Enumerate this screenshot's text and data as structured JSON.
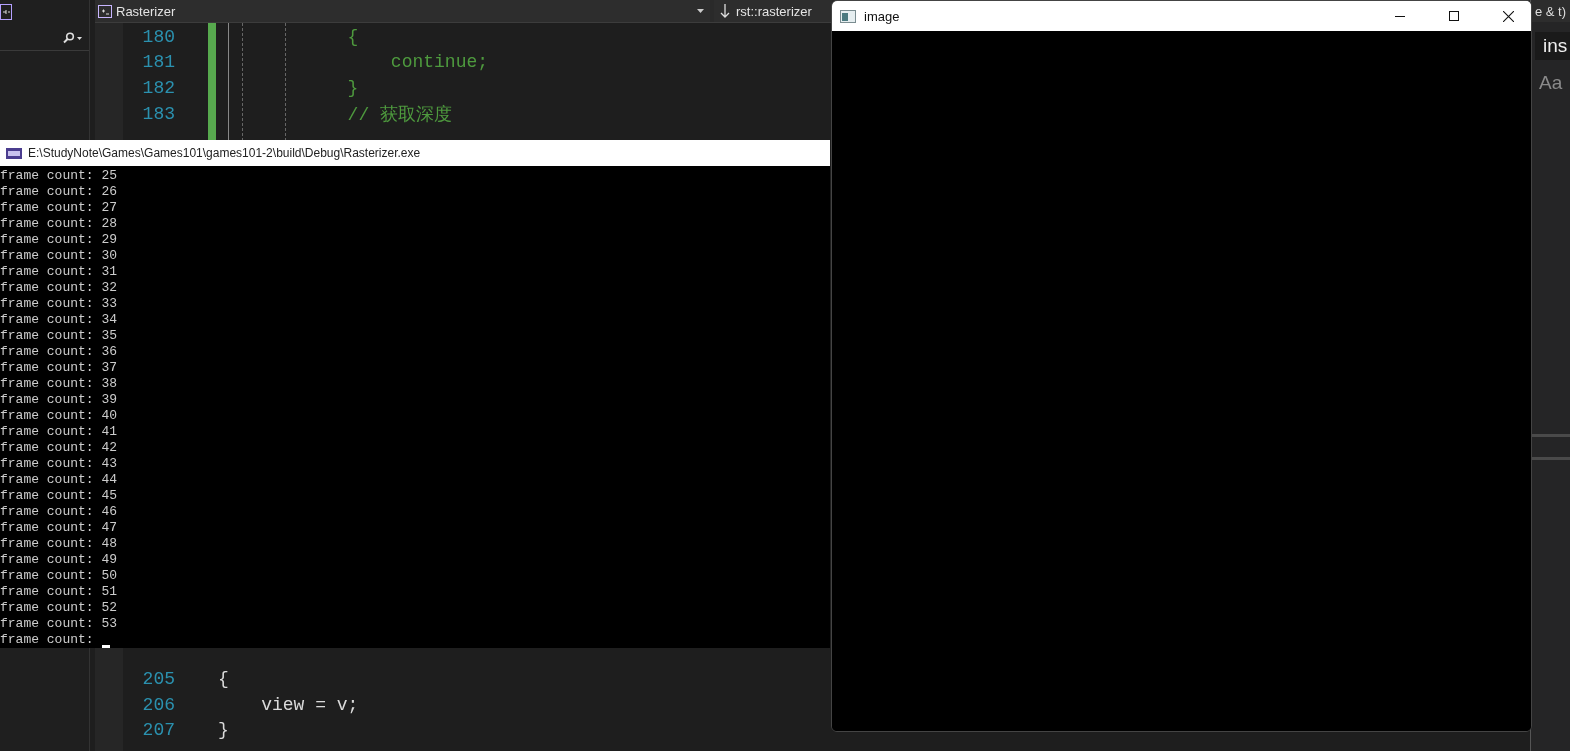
{
  "ide": {
    "nav_bar": {
      "file": "Rasterizer",
      "scope": "rst::rasterizer"
    },
    "code_top": [
      {
        "number": "180",
        "tokens": [
          {
            "kind": "inactive",
            "text": "            {"
          }
        ]
      },
      {
        "number": "181",
        "tokens": [
          {
            "kind": "inactive",
            "text": "                continue;"
          }
        ]
      },
      {
        "number": "182",
        "tokens": [
          {
            "kind": "inactive",
            "text": "            }"
          }
        ]
      },
      {
        "number": "183",
        "tokens": [
          {
            "kind": "inactive",
            "text": "            // 获取深度"
          }
        ]
      }
    ],
    "code_bottom": [
      {
        "number": "205",
        "tokens": [
          {
            "kind": "plain",
            "text": "{"
          }
        ]
      },
      {
        "number": "206",
        "tokens": [
          {
            "kind": "plain",
            "text": "    view = v;"
          }
        ]
      },
      {
        "number": "207",
        "tokens": [
          {
            "kind": "plain",
            "text": "}"
          }
        ]
      }
    ],
    "right_panel": {
      "header_fragment": "e & t)",
      "search_value": "ins",
      "case_toggle": "Aa"
    }
  },
  "console_window": {
    "title": "E:\\StudyNote\\Games\\Games101\\games101-2\\build\\Debug\\Rasterizer.exe",
    "lines": [
      "frame count: 25",
      "frame count: 26",
      "frame count: 27",
      "frame count: 28",
      "frame count: 29",
      "frame count: 30",
      "frame count: 31",
      "frame count: 32",
      "frame count: 33",
      "frame count: 34",
      "frame count: 35",
      "frame count: 36",
      "frame count: 37",
      "frame count: 38",
      "frame count: 39",
      "frame count: 40",
      "frame count: 41",
      "frame count: 42",
      "frame count: 43",
      "frame count: 44",
      "frame count: 45",
      "frame count: 46",
      "frame count: 47",
      "frame count: 48",
      "frame count: 49",
      "frame count: 50",
      "frame count: 51",
      "frame count: 52",
      "frame count: 53"
    ],
    "prompt": "frame count:"
  },
  "image_window": {
    "title": "image"
  }
}
